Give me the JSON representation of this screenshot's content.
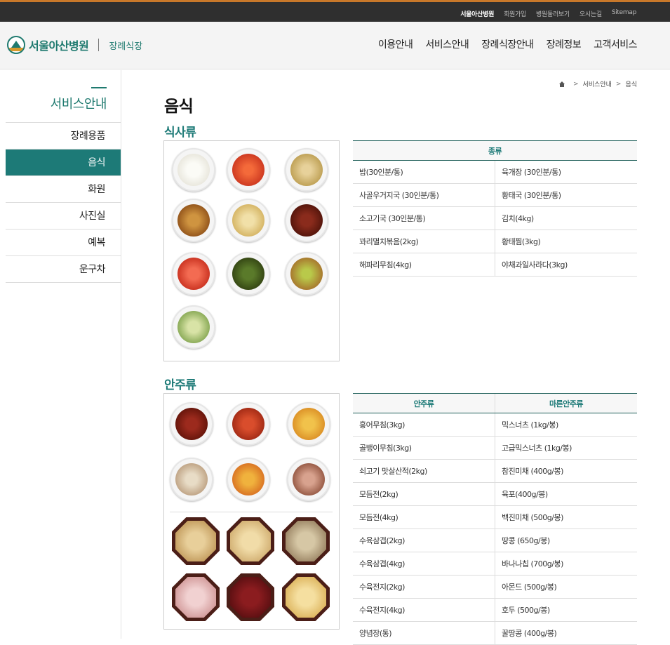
{
  "utility": {
    "links": [
      "서울아산병원",
      "회원가입",
      "병원둘러보기",
      "오시는길",
      "Sitemap"
    ]
  },
  "header": {
    "logo_text": "서울아산병원",
    "site_name": "장례식장",
    "nav": [
      "이용안내",
      "서비스안내",
      "장례식장안내",
      "장례정보",
      "고객서비스"
    ]
  },
  "sidebar": {
    "title": "서비스안내",
    "items": [
      "장례용품",
      "음식",
      "화원",
      "사진실",
      "예복",
      "운구차"
    ],
    "active_index": 1
  },
  "breadcrumb": [
    "서비스안내",
    "음식"
  ],
  "page": {
    "title": "음식"
  },
  "meals": {
    "title": "식사류",
    "table_header": "종류",
    "rows": [
      [
        "밥(30인분/통)",
        "육개장 (30인분/통)"
      ],
      [
        "사골우거지국 (30인분/통)",
        "황태국 (30인분/통)"
      ],
      [
        "소고기국 (30인분/통)",
        "김치(4kg)"
      ],
      [
        "꽈리멸치볶음(2kg)",
        "황태찜(3kg)"
      ],
      [
        "해파리무침(4kg)",
        "야채과일사라다(3kg)"
      ]
    ]
  },
  "snacks": {
    "title": "안주류",
    "headers": [
      "안주류",
      "마른안주류"
    ],
    "rows": [
      [
        "홍어무침(3kg)",
        "믹스너츠 (1kg/봉)"
      ],
      [
        "골뱅이무침(3kg)",
        "고급믹스너츠 (1kg/봉)"
      ],
      [
        "쇠고기 맛살산적(2kg)",
        "참진미채 (400g/봉)"
      ],
      [
        "모듬전(2kg)",
        "육포(400g/봉)"
      ],
      [
        "모듬전(4kg)",
        "백진미채 (500g/봉)"
      ],
      [
        "수육삼겹(2kg)",
        "땅콩 (650g/봉)"
      ],
      [
        "수육삼겹(4kg)",
        "바나나칩 (700g/봉)"
      ],
      [
        "수육전지(2kg)",
        "아몬드 (500g/봉)"
      ],
      [
        "수육전지(4kg)",
        "호두 (500g/봉)"
      ],
      [
        "양념장(통)",
        "꿀땅콩 (400g/봉)"
      ]
    ]
  },
  "colors": {
    "brand": "#1d7a77",
    "topbar": "#2f2f2f",
    "accent_line": "#c8782a"
  }
}
